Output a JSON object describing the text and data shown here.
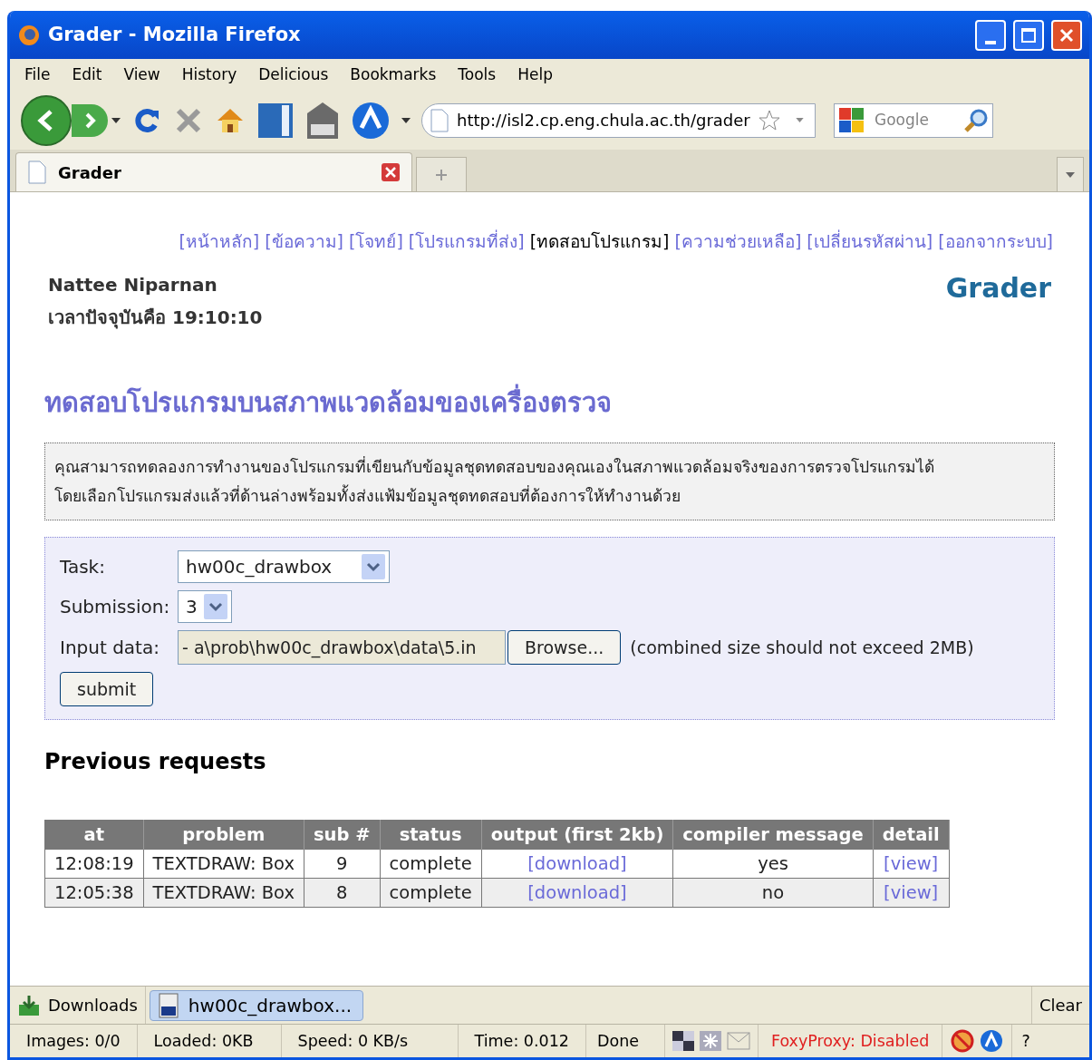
{
  "window": {
    "title": "Grader - Mozilla Firefox"
  },
  "menu": [
    "File",
    "Edit",
    "View",
    "History",
    "Delicious",
    "Bookmarks",
    "Tools",
    "Help"
  ],
  "address": {
    "value": "http://isl2.cp.eng.chula.ac.th/grader"
  },
  "search": {
    "placeholder": "Google"
  },
  "tabs": [
    {
      "label": "Grader",
      "selected": true
    }
  ],
  "nav_links": [
    {
      "label": "[หน้าหลัก]",
      "selected": false
    },
    {
      "label": "[ข้อความ]",
      "selected": false
    },
    {
      "label": "[โจทย์]",
      "selected": false
    },
    {
      "label": "[โปรแกรมที่ส่ง]",
      "selected": false
    },
    {
      "label": "[ทดสอบโปรแกรม]",
      "selected": true
    },
    {
      "label": "[ความช่วยเหลือ]",
      "selected": false
    },
    {
      "label": "[เปลี่ยนรหัสผ่าน]",
      "selected": false
    },
    {
      "label": "[ออกจากระบบ]",
      "selected": false
    }
  ],
  "user": {
    "name": "Nattee Niparnan",
    "time": "เวลาปัจจุบันคือ 19:10:10"
  },
  "site_title": "Grader",
  "heading": "ทดสอบโปรแกรมบนสภาพแวดล้อมของเครื่องตรวจ",
  "notice": [
    "คุณสามารถทดลองการทำงานของโปรแกรมที่เขียนกับข้อมูลชุดทดสอบของคุณเองในสภาพแวดล้อมจริงของการตรวจโปรแกรมได้",
    "โดยเลือกโปรแกรมส่งแล้วที่ด้านล่างพร้อมทั้งส่งแฟ้มข้อมูลชุดทดสอบที่ต้องการให้ทำงานด้วย"
  ],
  "form": {
    "task_label": "Task:",
    "task_value": "hw00c_drawbox",
    "submission_label": "Submission:",
    "submission_value": "3",
    "input_label": "Input data:",
    "input_value": "- a\\prob\\hw00c_drawbox\\data\\5.in",
    "browse": "Browse...",
    "note": "(combined size should not exceed 2MB)",
    "submit": "submit"
  },
  "previous_heading": "Previous requests",
  "table": {
    "columns": [
      "at",
      "problem",
      "sub #",
      "status",
      "output (first 2kb)",
      "compiler message",
      "detail"
    ],
    "rows": [
      [
        "12:08:19",
        "TEXTDRAW: Box",
        "9",
        "complete",
        "[download]",
        "yes",
        "[view]"
      ],
      [
        "12:05:38",
        "TEXTDRAW: Box",
        "8",
        "complete",
        "[download]",
        "no",
        "[view]"
      ]
    ]
  },
  "downloads_bar": {
    "label": "Downloads",
    "item": "hw00c_drawbox...",
    "clear": "Clear"
  },
  "status_bar": {
    "images": "Images: 0/0",
    "loaded": "Loaded: 0KB",
    "speed": "Speed: 0 KB/s",
    "time": "Time: 0.012",
    "done": "Done",
    "proxy": "FoxyProxy: Disabled",
    "help": "?"
  }
}
